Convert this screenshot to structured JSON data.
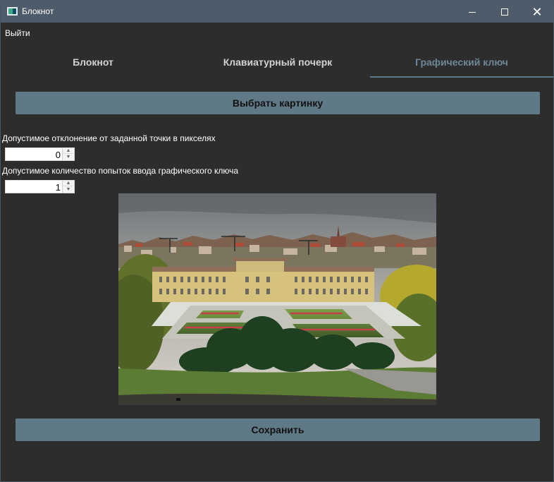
{
  "window": {
    "title": "Блокнот",
    "icon": "notepad-app-icon"
  },
  "controls": {
    "minimize_icon": "minimize-icon",
    "maximize_icon": "maximize-icon",
    "close_icon": "close-icon",
    "close_symbol": "✕"
  },
  "menu": {
    "exit_label": "Выйти"
  },
  "tabs": [
    {
      "label": "Блокнот",
      "active": false
    },
    {
      "label": "Клавиатурный почерк",
      "active": false
    },
    {
      "label": "Графический ключ",
      "active": true
    }
  ],
  "buttons": {
    "choose_picture": "Выбрать картинку",
    "save": "Сохранить"
  },
  "settings": {
    "deviation_label": "Допустимое отклонение от заданной точки в пикселях",
    "deviation_value": "0",
    "attempts_label": "Допустимое количество попыток ввода графического ключа",
    "attempts_value": "1"
  },
  "image": {
    "subject": "palace-garden-photo"
  },
  "colors": {
    "titlebar": "#4d5b6a",
    "background": "#2d2d2d",
    "accent": "#607986",
    "active_tab": "#6e8797"
  }
}
